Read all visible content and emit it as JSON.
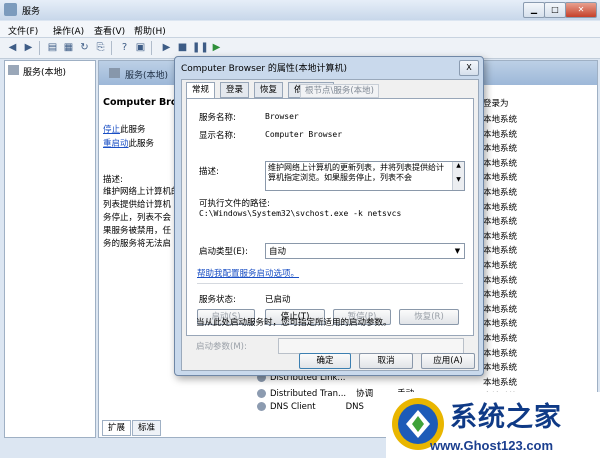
{
  "window": {
    "title": "服务"
  },
  "menu": [
    "文件(F)",
    "操作(A)",
    "查看(V)",
    "帮助(H)"
  ],
  "tree": {
    "label": "服务(本地)"
  },
  "list_header": {
    "label": "服务(本地)"
  },
  "description_panel": {
    "service_name": "Computer Browser",
    "stop_link": "停止",
    "stop_suffix": "此服务",
    "restart_link": "重启动",
    "restart_suffix": "此服务",
    "desc_label": "描述:",
    "desc_lines": [
      "维护网络上计算机的",
      "列表提供给计算机",
      "务停止，列表不会",
      "果服务被禁用，任",
      "务的服务将无法启"
    ]
  },
  "columns": {
    "startup_type": "登录为"
  },
  "logon_values": [
    "本地系统",
    "本地系统",
    "本地系统",
    "本地系统",
    "本地系统",
    "本地系统",
    "本地系统",
    "本地系统",
    "本地系统",
    "本地系统",
    "本地系统",
    "本地系统",
    "本地系统",
    "本地系统",
    "本地系统",
    "本地系统",
    "本地系统",
    "本地系统",
    "本地系统",
    "本地系统",
    "本地系统"
  ],
  "visible_services": [
    {
      "name": "Distributed Link..."
    },
    {
      "name": "Distributed Tran...",
      "desc": "协调",
      "status": "手动"
    },
    {
      "name": "DNS Client",
      "desc": "DNS"
    }
  ],
  "bottom_tabs": [
    "扩展",
    "标准"
  ],
  "dialog": {
    "title": "Computer Browser 的属性(本地计算机)",
    "close": "X",
    "tabs": [
      "常规",
      "登录",
      "恢复",
      "依存关系"
    ],
    "ghost_tab": "根节点\\服务(本地)",
    "service_name_label": "服务名称:",
    "service_name": "Browser",
    "display_name_label": "显示名称:",
    "display_name": "Computer Browser",
    "description_label": "描述:",
    "description": "维护网络上计算机的更新列表，并将列表提供给计算机指定浏览。如果服务停止，列表不会",
    "path_label": "可执行文件的路径:",
    "path": "C:\\Windows\\System32\\svchost.exe -k netsvcs",
    "startup_type_label": "启动类型(E):",
    "startup_type": "自动",
    "help_link": "帮助我配置服务启动选项。",
    "status_label": "服务状态:",
    "status": "已启动",
    "buttons": {
      "start": "启动(S)",
      "stop": "停止(T)",
      "pause": "暂停(P)",
      "resume": "恢复(R)"
    },
    "hint": "当从此处启动服务时，您可指定所适用的启动参数。",
    "params_label": "启动参数(M):",
    "ok": "确定",
    "cancel": "取消",
    "apply": "应用(A)"
  },
  "watermark": {
    "title": "系统之家",
    "url": "www.Ghost123.com"
  }
}
